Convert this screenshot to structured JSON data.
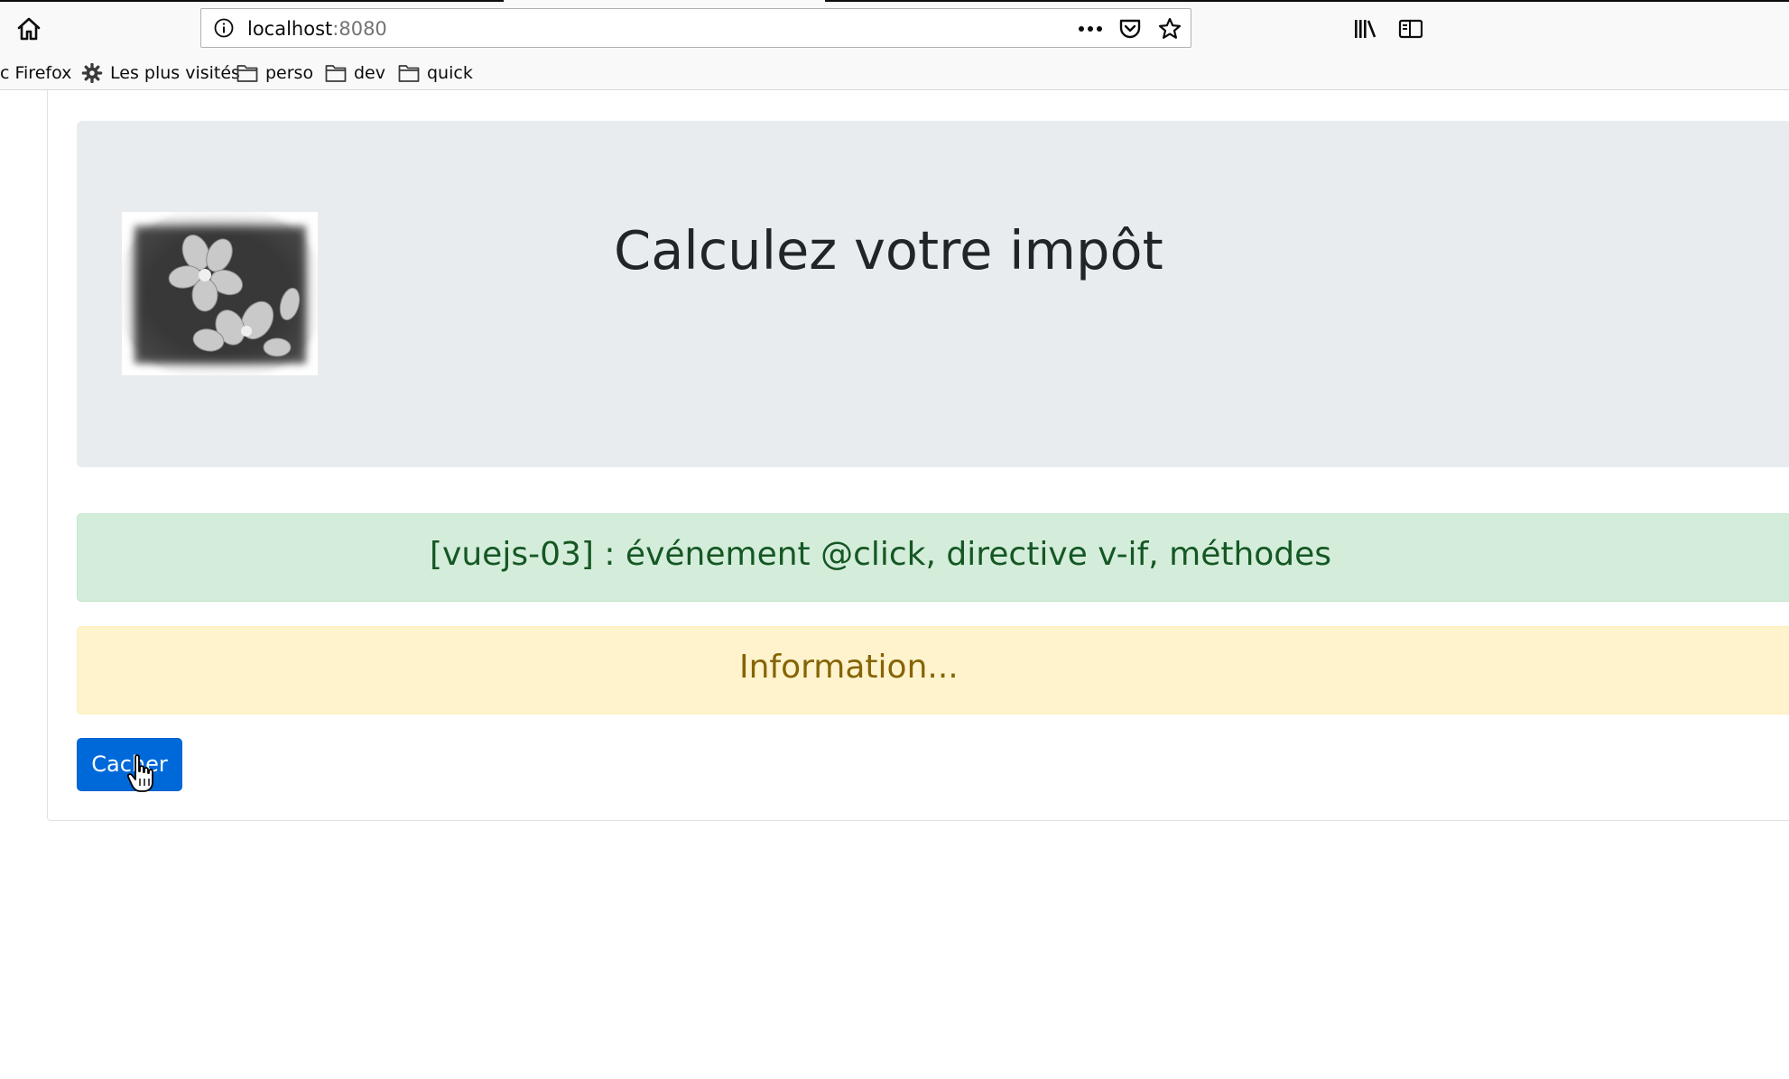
{
  "browser": {
    "url_host": "localhost",
    "url_port": ":8080",
    "bookmarks": [
      {
        "label": "c Firefox",
        "icon": "none"
      },
      {
        "label": "Les plus visités",
        "icon": "gear-icon"
      },
      {
        "label": "perso",
        "icon": "folder-icon"
      },
      {
        "label": "dev",
        "icon": "folder-icon"
      },
      {
        "label": "quick",
        "icon": "folder-icon"
      }
    ]
  },
  "page": {
    "title": "Calculez votre impôt",
    "success_alert": "[vuejs-03] : événement @click, directive v-if, méthodes",
    "info_alert": "Information...",
    "hide_button": "Cacher"
  },
  "colors": {
    "jumbotron_bg": "#e9ecef",
    "success_bg": "#d4edda",
    "success_text": "#155724",
    "warning_bg": "#fff3cd",
    "warning_text": "#856404",
    "primary": "#0069d9"
  }
}
